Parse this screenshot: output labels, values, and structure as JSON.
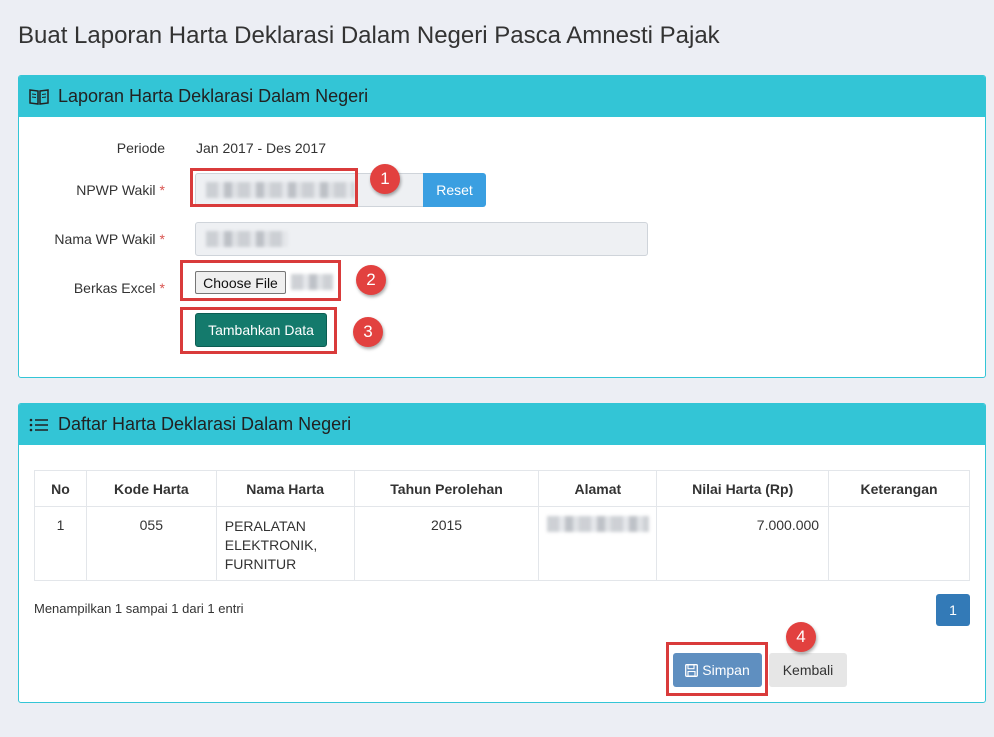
{
  "page": {
    "title": "Buat Laporan Harta Deklarasi Dalam Negeri Pasca Amnesti Pajak"
  },
  "form_panel": {
    "title": "Laporan Harta Deklarasi Dalam Negeri",
    "icon": "book-icon",
    "periode": {
      "label": "Periode",
      "value": "Jan 2017 - Des 2017"
    },
    "npwp": {
      "label": "NPWP Wakil",
      "required_mark": "*",
      "reset_label": "Reset"
    },
    "nama_wp": {
      "label": "Nama WP Wakil",
      "required_mark": "*"
    },
    "berkas": {
      "label": "Berkas Excel",
      "required_mark": "*",
      "choose_label": "Choose File"
    },
    "tambahkan_label": "Tambahkan Data"
  },
  "table_panel": {
    "title": "Daftar Harta Deklarasi Dalam Negeri",
    "icon": "list-icon",
    "columns": [
      "No",
      "Kode Harta",
      "Nama Harta",
      "Tahun Perolehan",
      "Alamat",
      "Nilai Harta (Rp)",
      "Keterangan"
    ],
    "rows": [
      {
        "no": "1",
        "kode": "055",
        "nama": "PERALATAN ELEKTRONIK, FURNITUR",
        "tahun": "2015",
        "alamat": "",
        "nilai": "7.000.000",
        "keterangan": ""
      }
    ],
    "info": "Menampilkan 1 sampai 1 dari 1 entri",
    "page": "1",
    "simpan_label": "Simpan",
    "kembali_label": "Kembali"
  },
  "annotations": [
    "1",
    "2",
    "3",
    "4"
  ],
  "colors": {
    "header": "#33c5d6",
    "accent_teal": "#147a6c",
    "reset_blue": "#3a9fe1",
    "callout_red": "#e2413f"
  }
}
